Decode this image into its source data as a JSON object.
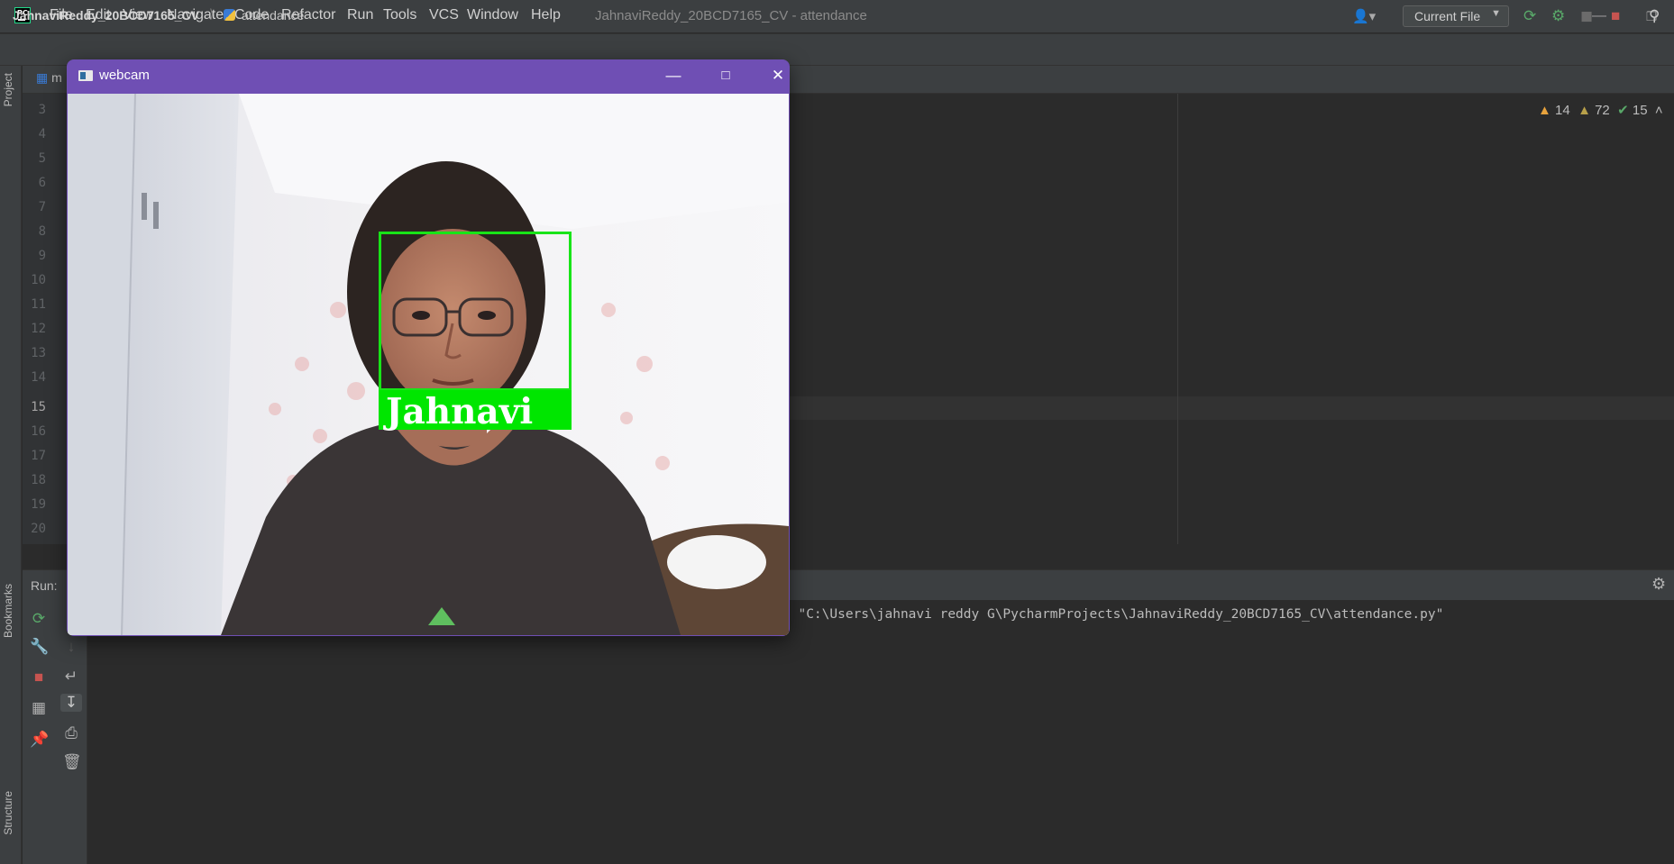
{
  "menu": {
    "items": [
      "File",
      "Edit",
      "View",
      "Navigate",
      "Code",
      "Refactor",
      "Run",
      "Tools",
      "VCS",
      "Window",
      "Help"
    ],
    "window_title": "JahnaviReddy_20BCD7165_CV - attendance"
  },
  "navbar": {
    "project": "JahnaviReddy_20BCD7165_CV",
    "file": "attendance",
    "run_config": "Current File"
  },
  "editor": {
    "tab_fragment": "m",
    "line_numbers": [
      "3",
      "4",
      "5",
      "6",
      "7",
      "8",
      "9",
      "10",
      "11",
      "12",
      "13",
      "14",
      "15",
      "16",
      "17",
      "18",
      "19",
      "20"
    ],
    "current_line": "15",
    "inspections": {
      "errors": "14",
      "warnings": "72",
      "ok": "15"
    }
  },
  "tool_windows": {
    "project": "Project",
    "bookmarks": "Bookmarks",
    "structure": "Structure"
  },
  "run": {
    "label": "Run:",
    "console_line": "\" \"C:\\Users\\jahnavi reddy G\\PycharmProjects\\JahnaviReddy_20BCD7165_CV\\attendance.py\""
  },
  "webcam": {
    "title": "webcam",
    "detected_name": "Jahnavi"
  },
  "colors": {
    "ide_bg": "#2b2b2b",
    "panel_bg": "#3c3f41",
    "webcam_titlebar": "#6f4fb4",
    "detection_green": "#00e600"
  }
}
